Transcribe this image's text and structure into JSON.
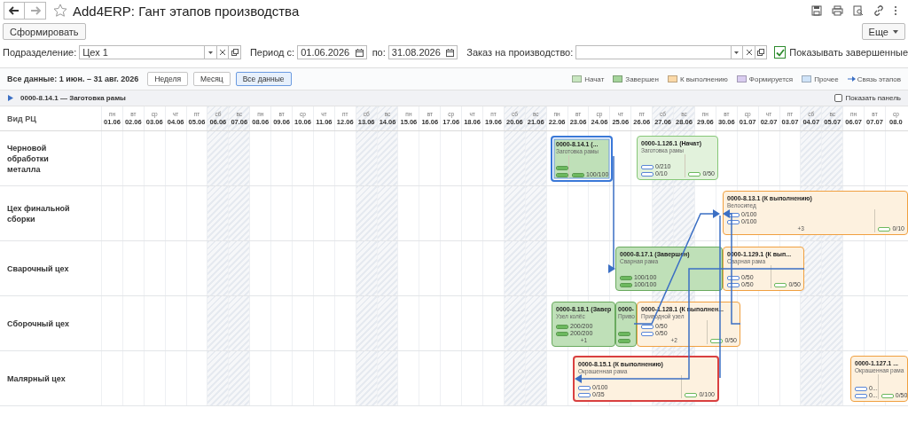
{
  "window": {
    "title": "Add4ERP: Гант этапов производства"
  },
  "command_bar": {
    "generate_button": "Сформировать",
    "more_button": "Еще"
  },
  "filters": {
    "department": {
      "label": "Подразделение:",
      "value": "Цех 1"
    },
    "period_from": {
      "label": "Период с:",
      "value": "01.06.2026"
    },
    "period_to": {
      "label": "по:",
      "value": "31.08.2026"
    },
    "order": {
      "label": "Заказ на производство:"
    },
    "show_completed": {
      "label": "Показывать завершенные",
      "checked": true
    }
  },
  "gantt_toolbar": {
    "summary": "Все данные: 1 июн. – 31 авг. 2026",
    "scale_buttons": [
      {
        "label": "Неделя",
        "selected": false
      },
      {
        "label": "Месяц",
        "selected": false
      },
      {
        "label": "Все данные",
        "selected": true
      }
    ],
    "legend": [
      {
        "kind": "status",
        "label": "Начат",
        "color": "#c8e6c0"
      },
      {
        "kind": "status",
        "label": "Завершен",
        "color": "#a5d49b"
      },
      {
        "kind": "status",
        "label": "К выполнению",
        "color": "#fbd9a8"
      },
      {
        "kind": "status",
        "label": "Формируется",
        "color": "#d9ccf0"
      },
      {
        "kind": "status",
        "label": "Прочее",
        "color": "#cfe3f8"
      },
      {
        "kind": "link",
        "label": "Связь этапов"
      }
    ]
  },
  "group": {
    "title": "0000-8.14.1 — Заготовка рамы",
    "show_panel": {
      "label": "Показать панель",
      "checked": false
    }
  },
  "row_header": "Вид РЦ",
  "days": [
    {
      "weekday": "пн",
      "date": "01.06",
      "weekend": false
    },
    {
      "weekday": "вт",
      "date": "02.06",
      "weekend": false
    },
    {
      "weekday": "ср",
      "date": "03.06",
      "weekend": false
    },
    {
      "weekday": "чт",
      "date": "04.06",
      "weekend": false
    },
    {
      "weekday": "пт",
      "date": "05.06",
      "weekend": false
    },
    {
      "weekday": "сб",
      "date": "06.06",
      "weekend": true
    },
    {
      "weekday": "вс",
      "date": "07.06",
      "weekend": true
    },
    {
      "weekday": "пн",
      "date": "08.06",
      "weekend": false
    },
    {
      "weekday": "вт",
      "date": "09.06",
      "weekend": false
    },
    {
      "weekday": "ср",
      "date": "10.06",
      "weekend": false
    },
    {
      "weekday": "чт",
      "date": "11.06",
      "weekend": false
    },
    {
      "weekday": "пт",
      "date": "12.06",
      "weekend": false
    },
    {
      "weekday": "сб",
      "date": "13.06",
      "weekend": true
    },
    {
      "weekday": "вс",
      "date": "14.06",
      "weekend": true
    },
    {
      "weekday": "пн",
      "date": "15.06",
      "weekend": false
    },
    {
      "weekday": "вт",
      "date": "16.06",
      "weekend": false
    },
    {
      "weekday": "ср",
      "date": "17.06",
      "weekend": false
    },
    {
      "weekday": "чт",
      "date": "18.06",
      "weekend": false
    },
    {
      "weekday": "пт",
      "date": "19.06",
      "weekend": false
    },
    {
      "weekday": "сб",
      "date": "20.06",
      "weekend": true
    },
    {
      "weekday": "вс",
      "date": "21.06",
      "weekend": true
    },
    {
      "weekday": "пн",
      "date": "22.06",
      "weekend": false
    },
    {
      "weekday": "вт",
      "date": "23.06",
      "weekend": false
    },
    {
      "weekday": "ср",
      "date": "24.06",
      "weekend": false
    },
    {
      "weekday": "чт",
      "date": "25.06",
      "weekend": false
    },
    {
      "weekday": "пт",
      "date": "26.06",
      "weekend": false
    },
    {
      "weekday": "сб",
      "date": "27.06",
      "weekend": true
    },
    {
      "weekday": "вс",
      "date": "28.06",
      "weekend": true
    },
    {
      "weekday": "пн",
      "date": "29.06",
      "weekend": false
    },
    {
      "weekday": "вт",
      "date": "30.06",
      "weekend": false
    },
    {
      "weekday": "ср",
      "date": "01.07",
      "weekend": false
    },
    {
      "weekday": "чт",
      "date": "02.07",
      "weekend": false
    },
    {
      "weekday": "пт",
      "date": "03.07",
      "weekend": false
    },
    {
      "weekday": "сб",
      "date": "04.07",
      "weekend": true
    },
    {
      "weekday": "вс",
      "date": "05.07",
      "weekend": true
    },
    {
      "weekday": "пн",
      "date": "06.07",
      "weekend": false
    },
    {
      "weekday": "вт",
      "date": "07.07",
      "weekend": false
    },
    {
      "weekday": "ср",
      "date": "08.0",
      "weekend": false
    }
  ],
  "rows": [
    {
      "name": "Черновой обработки металла"
    },
    {
      "name": "Цех финальной сборки"
    },
    {
      "name": "Сварочный цех"
    },
    {
      "name": "Сборочный цех"
    },
    {
      "name": "Малярный цех"
    }
  ],
  "cards": [
    {
      "title": "0000-8.14.1 (...",
      "subtitle": "Заготовка рамы",
      "kind": "done",
      "selected": true,
      "overdue": false,
      "materials": [
        {
          "level": 1
        },
        {
          "level": 1
        }
      ],
      "outputs": [
        {
          "level": 1,
          "value": "100/100"
        }
      ]
    },
    {
      "title": "0000-1.126.1 (Начат)",
      "subtitle": "Заготовка рамы",
      "kind": "started",
      "selected": false,
      "overdue": false,
      "materials": [
        {
          "level": 0,
          "value": "0/210"
        },
        {
          "level": 0,
          "value": "0/10"
        }
      ],
      "outputs": [
        {
          "level": 0,
          "value": "0/50"
        }
      ]
    },
    {
      "title": "0000-8.13.1 (К выполнению)",
      "subtitle": "Велосипед",
      "kind": "todo",
      "selected": false,
      "overdue": false,
      "materials": [
        {
          "level": 0,
          "value": "0/100"
        },
        {
          "level": 0,
          "value": "0/100"
        }
      ],
      "extra": "+3",
      "outputs": [
        {
          "level": 0,
          "value": "0/10"
        }
      ]
    },
    {
      "title": "0000-8.17.1 (Завершен)",
      "subtitle": "Сварная рама",
      "kind": "done",
      "selected": false,
      "overdue": false,
      "materials": [
        {
          "level": 1,
          "value": "100/100"
        },
        {
          "level": 1,
          "value": "100/100"
        }
      ]
    },
    {
      "title": "0000-1.129.1 (К вып...",
      "subtitle": "Сварная рама",
      "kind": "todo",
      "selected": false,
      "overdue": false,
      "materials": [
        {
          "level": 0,
          "value": "0/50"
        },
        {
          "level": 0,
          "value": "0/50"
        }
      ],
      "outputs": [
        {
          "level": 0,
          "value": "0/50"
        }
      ]
    },
    {
      "title": "0000-8.18.1 (Завер",
      "subtitle": "Узел колёс",
      "kind": "done",
      "selected": false,
      "overdue": false,
      "materials": [
        {
          "level": 1,
          "value": "200/200"
        },
        {
          "level": 1,
          "value": "200/200"
        }
      ],
      "extra": "+1"
    },
    {
      "title": "0000-",
      "subtitle": "Приво",
      "kind": "done",
      "selected": false,
      "overdue": false,
      "materials": [
        {
          "level": 1
        },
        {
          "level": 1
        }
      ]
    },
    {
      "title": "0000-1.128.1 (К выполнен...",
      "subtitle": "Приводной узел",
      "kind": "todo",
      "selected": false,
      "overdue": false,
      "materials": [
        {
          "level": 0,
          "value": "0/50"
        },
        {
          "level": 0,
          "value": "0/50"
        }
      ],
      "extra": "+2",
      "outputs": [
        {
          "level": 0,
          "value": "0/50"
        }
      ]
    },
    {
      "title": "0000-8.15.1 (К выполнению)",
      "subtitle": "Окрашенная рама",
      "kind": "todo",
      "selected": false,
      "overdue": true,
      "materials": [
        {
          "level": 0,
          "value": "0/100"
        },
        {
          "level": 0,
          "value": "0/35"
        }
      ],
      "outputs": [
        {
          "level": 0,
          "value": "0/100"
        }
      ]
    },
    {
      "title": "0000-1.127.1 ...",
      "subtitle": "Окрашенная рама",
      "kind": "todo",
      "selected": false,
      "overdue": false,
      "materials": [
        {
          "level": 0,
          "value": "0..."
        },
        {
          "level": 0,
          "value": "0..."
        }
      ],
      "outputs": [
        {
          "level": 0,
          "value": "0/50"
        }
      ]
    }
  ]
}
